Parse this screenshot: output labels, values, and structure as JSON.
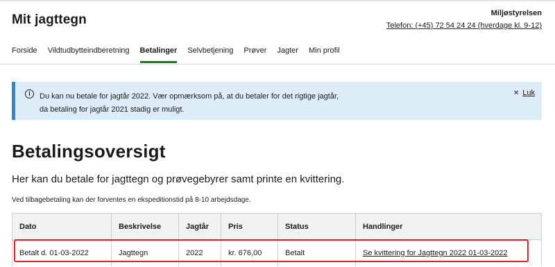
{
  "header": {
    "title": "Mit jagttegn",
    "org": "Miljøstyrelsen",
    "phone": "Telefon: (+45) 72 54 24 24 (hverdage kl. 9-12)"
  },
  "nav": {
    "items": [
      {
        "label": "Forside",
        "active": false
      },
      {
        "label": "Vildtudbytteindberetning",
        "active": false
      },
      {
        "label": "Betalinger",
        "active": true
      },
      {
        "label": "Selvbetjening",
        "active": false
      },
      {
        "label": "Prøver",
        "active": false
      },
      {
        "label": "Jagter",
        "active": false
      },
      {
        "label": "Min profil",
        "active": false
      }
    ]
  },
  "alert": {
    "icon": "info-icon",
    "line1": "Du kan nu betale for jagtår 2022. Vær opmærksom på, at du betaler for det rigtige jagtår,",
    "line2": "da betaling for jagtår 2021 stadig er muligt.",
    "close_symbol": "✕",
    "close_label": "Luk"
  },
  "page": {
    "title": "Betalingsoversigt",
    "lead": "Her kan du betale for jagttegn og prøvegebyrer samt printe en kvittering.",
    "note": "Ved tilbagebetaling kan der forventes en ekspeditionstid på 8-10 arbejdsdage."
  },
  "table": {
    "headers": [
      "Dato",
      "Beskrivelse",
      "Jagtår",
      "Pris",
      "Status",
      "Handlinger"
    ],
    "rows": [
      {
        "dato": "Betalt d. 01-03-2022",
        "beskrivelse": "Jagttegn",
        "jagtaar": "2022",
        "pris": "kr. 676,00",
        "status": "Betalt",
        "handling": "Se kvittering for Jagttegn 2022 01-03-2022"
      }
    ]
  },
  "colors": {
    "accent_green": "#2b6e2f",
    "alert_bg": "#ddedf7",
    "alert_border": "#2f8ac4",
    "highlight": "#e02020"
  }
}
